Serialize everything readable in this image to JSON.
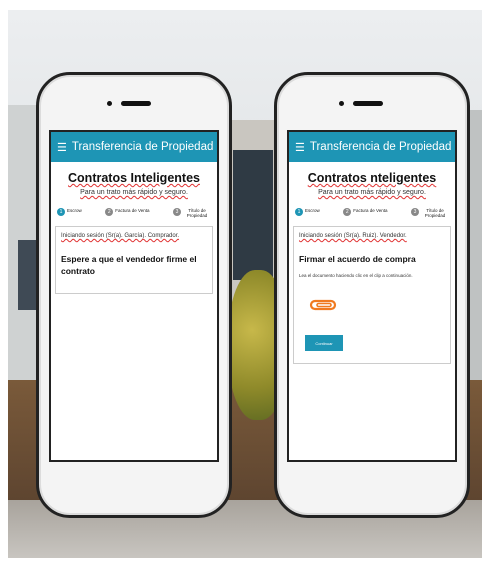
{
  "phones": [
    {
      "app_bar_title": "Transferencia de Propiedad",
      "title": "Contratos Inteligentes",
      "subtitle": "Para un trato más rápido y seguro.",
      "steps": [
        "Escrow",
        "Factura de Venta",
        "Título de Propiedad"
      ],
      "session_text": "Iniciando sesión (Sr(a). García). Comprador.",
      "message": "Espere a que el vendedor firme el contrato"
    },
    {
      "app_bar_title": "Transferencia de Propiedad",
      "title": "Contratos nteligentes",
      "subtitle": "Para un trato más rápido y seguro.",
      "steps": [
        "Escrow",
        "Factura de Venta",
        "Título de Propiedad"
      ],
      "session_text": "Iniciando sesión (Sr(a). Ruiz). Vendedor.",
      "message": "Firmar el acuerdo de compra",
      "description": "Lea el documento haciendo clic en el clip a continuación.",
      "button_label": "Continuar"
    }
  ],
  "icons": {
    "menu": "menu-icon",
    "attachment": "paperclip-icon"
  },
  "colors": {
    "accent": "#1e95b5",
    "clip": "#f07a20"
  }
}
